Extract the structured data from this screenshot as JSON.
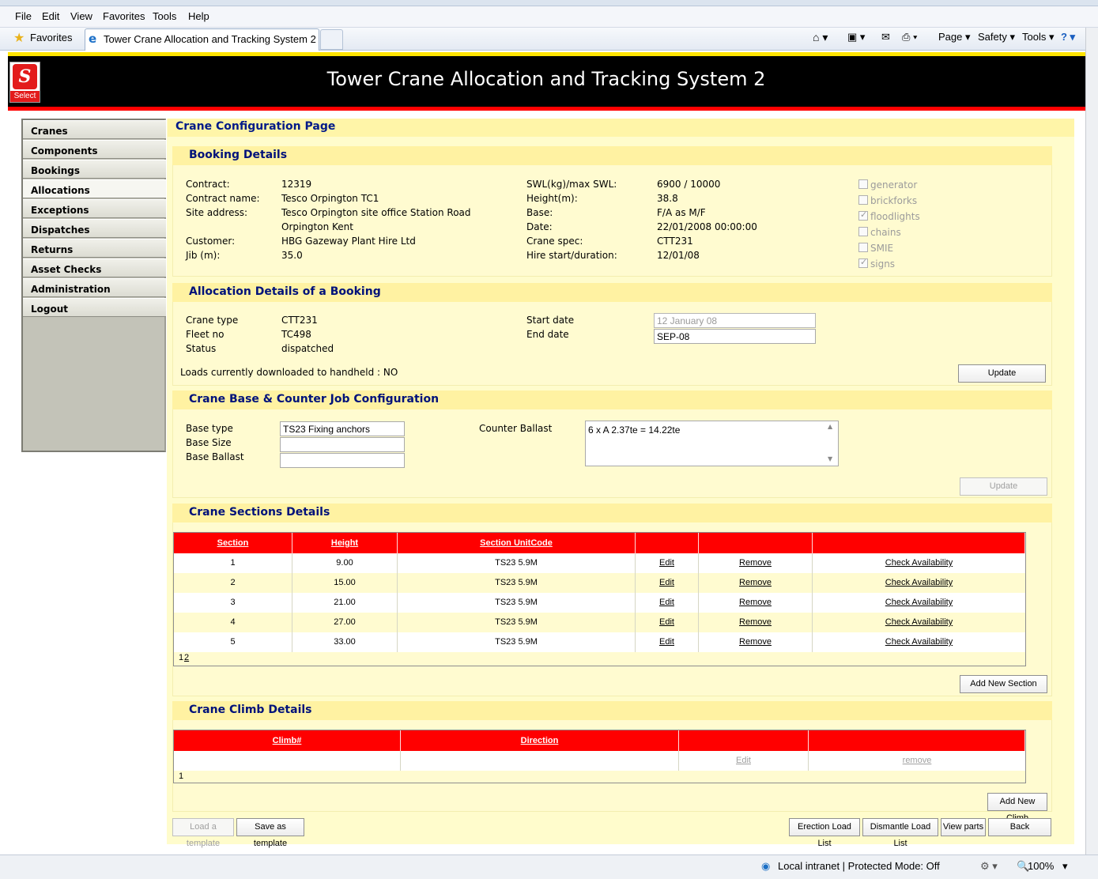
{
  "browser": {
    "menu": [
      "File",
      "Edit",
      "View",
      "Favorites",
      "Tools",
      "Help"
    ],
    "favorites_label": "Favorites",
    "tab_title": "Tower Crane Allocation and Tracking System 2",
    "toolbar": {
      "page": "Page ▾",
      "safety": "Safety ▾",
      "tools": "Tools ▾"
    },
    "status": {
      "zone": "Local intranet | Protected Mode: Off",
      "zoom": "100%"
    }
  },
  "header": {
    "title": "Tower Crane Allocation and Tracking System 2",
    "logo_text": "Select"
  },
  "sidebar": {
    "items": [
      "Cranes",
      "Components",
      "Bookings",
      "Allocations",
      "Exceptions",
      "Dispatches",
      "Returns",
      "Asset Checks",
      "Administration",
      "Logout"
    ],
    "active": "Allocations"
  },
  "page_title": "Crane Configuration Page",
  "booking": {
    "title": "Booking Details",
    "contract_label": "Contract:",
    "contract": "12319",
    "contract_name_label": "Contract name:",
    "contract_name": "Tesco Orpington TC1",
    "site_address_label": "Site address:",
    "site_address_1": "Tesco Orpington site office Station Road",
    "site_address_2": "Orpington Kent",
    "customer_label": "Customer:",
    "customer": "HBG Gazeway Plant Hire Ltd",
    "jib_label": "Jib (m):",
    "jib": "35.0",
    "swl_label": "SWL(kg)/max SWL:",
    "swl": "6900 / 10000",
    "height_label": "Height(m):",
    "height": "38.8",
    "base_label": "Base:",
    "base": "F/A as M/F",
    "date_label": "Date:",
    "date": "22/01/2008 00:00:00",
    "crane_spec_label": "Crane spec:",
    "crane_spec": "CTT231",
    "hire_label": "Hire start/duration:",
    "hire": "12/01/08",
    "options": [
      {
        "label": "generator",
        "checked": false
      },
      {
        "label": "brickforks",
        "checked": false
      },
      {
        "label": "floodlights",
        "checked": true
      },
      {
        "label": "chains",
        "checked": false
      },
      {
        "label": "SMIE",
        "checked": false
      },
      {
        "label": "signs",
        "checked": true
      }
    ]
  },
  "allocation": {
    "title": "Allocation Details of a Booking",
    "crane_type_label": "Crane type",
    "crane_type": "CTT231",
    "fleet_label": "Fleet no",
    "fleet": "TC498",
    "status_label": "Status",
    "status": "dispatched",
    "start_label": "Start date",
    "start_value": "12 January 08",
    "end_label": "End date",
    "end_value": "SEP-08",
    "loads_text": "Loads currently downloaded to handheld : NO",
    "update_label": "Update"
  },
  "base_config": {
    "title": "Crane Base & Counter Job Configuration",
    "base_type_label": "Base type",
    "base_type": "TS23 Fixing anchors",
    "base_size_label": "Base Size",
    "base_size": "",
    "base_ballast_label": "Base Ballast",
    "base_ballast": "",
    "counter_label": "Counter Ballast",
    "counter_value": "6 x A 2.37te = 14.22te",
    "update_label": "Update"
  },
  "sections": {
    "title": "Crane Sections Details",
    "headers": [
      "Section",
      "Height",
      "Section UnitCode"
    ],
    "rows": [
      {
        "section": "1",
        "height": "9.00",
        "code": "TS23 5.9M"
      },
      {
        "section": "2",
        "height": "15.00",
        "code": "TS23 5.9M"
      },
      {
        "section": "3",
        "height": "21.00",
        "code": "TS23 5.9M"
      },
      {
        "section": "4",
        "height": "27.00",
        "code": "TS23 5.9M"
      },
      {
        "section": "5",
        "height": "33.00",
        "code": "TS23 5.9M"
      }
    ],
    "edit_label": "Edit",
    "remove_label": "Remove",
    "check_label": "Check Availability",
    "pager_current": "1",
    "pager_next": "2",
    "add_label": "Add New Section"
  },
  "climb": {
    "title": "Crane Climb Details",
    "headers": [
      "Climb#",
      "Direction"
    ],
    "edit_label": "Edit",
    "remove_label": "remove",
    "pager": "1",
    "add_label": "Add New Climb"
  },
  "footer_buttons": {
    "load_template": "Load a template",
    "save_template": "Save as template",
    "erection": "Erection Load List",
    "dismantle": "Dismantle Load List",
    "view_parts": "View parts",
    "back": "Back"
  }
}
